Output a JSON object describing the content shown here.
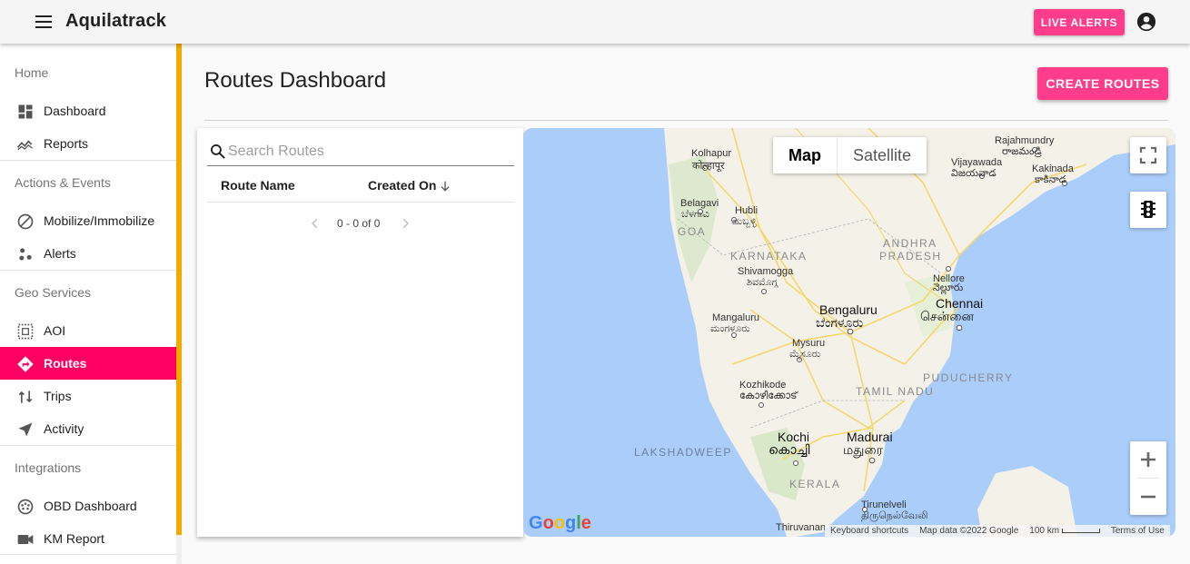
{
  "app": {
    "title": "Aquilatrack",
    "live_alerts_label": "LIVE ALERTS"
  },
  "sidebar": {
    "sections": [
      {
        "title": "Home",
        "items": [
          {
            "label": "Dashboard",
            "icon": "dashboard-icon"
          },
          {
            "label": "Reports",
            "icon": "reports-icon"
          }
        ]
      },
      {
        "title": "Actions & Events",
        "items": [
          {
            "label": "Mobilize/Immobilize",
            "icon": "block-icon"
          },
          {
            "label": "Alerts",
            "icon": "alerts-icon"
          }
        ]
      },
      {
        "title": "Geo Services",
        "items": [
          {
            "label": "AOI",
            "icon": "aoi-icon"
          },
          {
            "label": "Routes",
            "icon": "routes-icon",
            "active": true
          },
          {
            "label": "Trips",
            "icon": "trips-icon"
          },
          {
            "label": "Activity",
            "icon": "navigation-icon"
          }
        ]
      },
      {
        "title": "Integrations",
        "items": [
          {
            "label": "OBD Dashboard",
            "icon": "obd-icon"
          },
          {
            "label": "KM Report",
            "icon": "video-icon"
          }
        ]
      }
    ]
  },
  "main": {
    "title": "Routes Dashboard",
    "create_label": "CREATE ROUTES"
  },
  "routes_table": {
    "search_placeholder": "Search Routes",
    "search_value": "",
    "columns": [
      "Route Name",
      "Created On"
    ],
    "rows": [],
    "pagination": "0 - 0 of 0"
  },
  "map": {
    "map_type_options": [
      "Map",
      "Satellite"
    ],
    "selected_type": "Map",
    "google_logo": "Google",
    "attribution": {
      "shortcuts": "Keyboard shortcuts",
      "data": "Map data ©2022 Google",
      "scale": "100 km",
      "terms": "Terms of Use"
    },
    "labels": {
      "kolhapur": "Kolhapur",
      "kolhapur_local": "कोल्हापूर",
      "belagavi": "Belagavi",
      "belagavi_local": "ಬೆಳಗಾವಿ",
      "hubli": "Hubli",
      "hubli_local": "ಹುಬ್ಬಳ್ಳಿ",
      "goa": "GOA",
      "karnataka": "KARNATAKA",
      "shivamogga": "Shivamogga",
      "shivamogga_local": "ಶಿವಮೊಗ್ಗ",
      "mangaluru": "Mangaluru",
      "mangaluru_local": "ಮಂಗಳೂರು",
      "bengaluru": "Bengaluru",
      "bengaluru_local": "ಬೆಂಗಳೂರು",
      "mysuru": "Mysuru",
      "mysuru_local": "ಮೈಸೂರು",
      "kozhikode": "Kozhikode",
      "kozhikode_local": "കോഴിക്കോട്",
      "kochi": "Kochi",
      "kochi_local": "കൊച്ചി",
      "lakshadweep": "LAKSHADWEEP",
      "kerala": "KERALA",
      "madurai": "Madurai",
      "madurai_local": "மதுரை",
      "tamil_nadu": "TAMIL NADU",
      "puducherry": "PUDUCHERRY",
      "chennai": "Chennai",
      "chennai_local": "சென்னை",
      "nellore": "Nellore",
      "nellore_local": "నెల్లూరు",
      "andhra": "ANDHRA",
      "pradesh": "PRADESH",
      "vijayawada": "Vijayawada",
      "vijayawada_local": "విజయవాడ",
      "rajahmundry": "Rajahmundry",
      "rajahmundry_local": "రాజమండ్రి",
      "kakinada": "Kakinada",
      "kakinada_local": "కాకినాడ",
      "tirunelveli": "Tirunelveli",
      "tirunelveli_local": "திருநெல்வேலி",
      "thiruvananthapuram": "Thiruvanan"
    }
  }
}
